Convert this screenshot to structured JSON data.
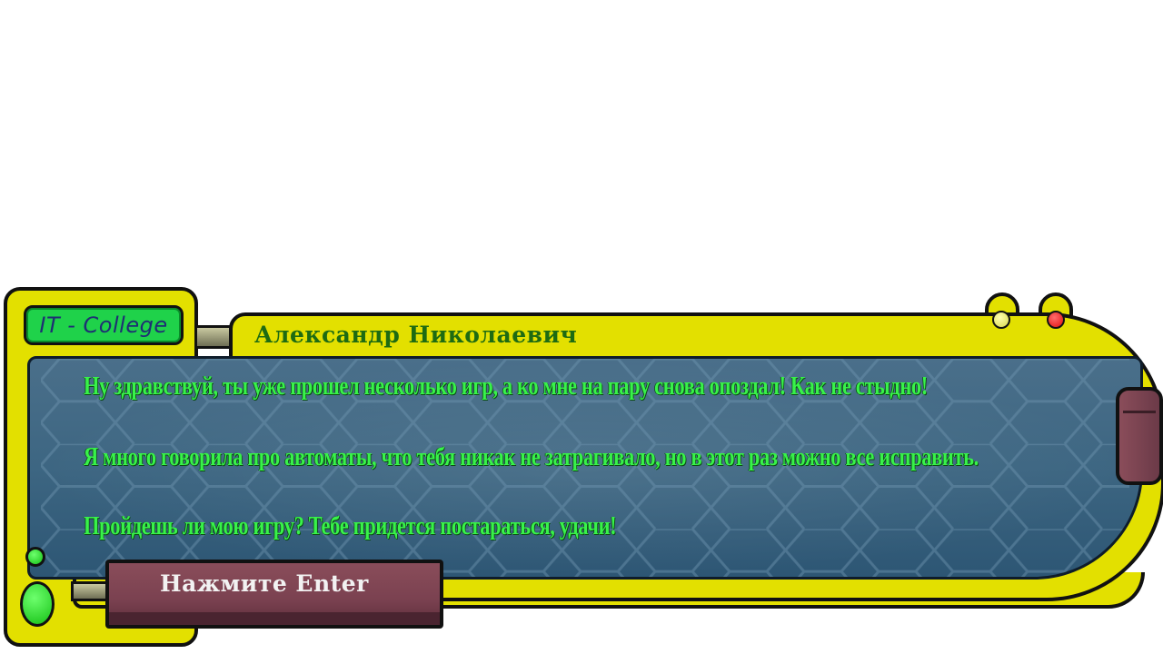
{
  "logo": {
    "text": "IT - College"
  },
  "dialog": {
    "speaker": "Александр Николаевич",
    "lines": [
      "Ну здравствуй, ты уже прошел несколько игр, а ко мне на пару снова опоздал! Как не стыдно!",
      "Я много говорила про автоматы, что тебя никак не затрагивало, но в этот раз можно все исправить.",
      "Пройдешь ли мою игру? Тебе придется постараться, удачи!"
    ],
    "continue_label": "Нажмите Enter"
  },
  "colors": {
    "frame": "#e3e000",
    "text": "#38f24a",
    "speaker": "#1e6b12",
    "button": "#7a4150"
  }
}
